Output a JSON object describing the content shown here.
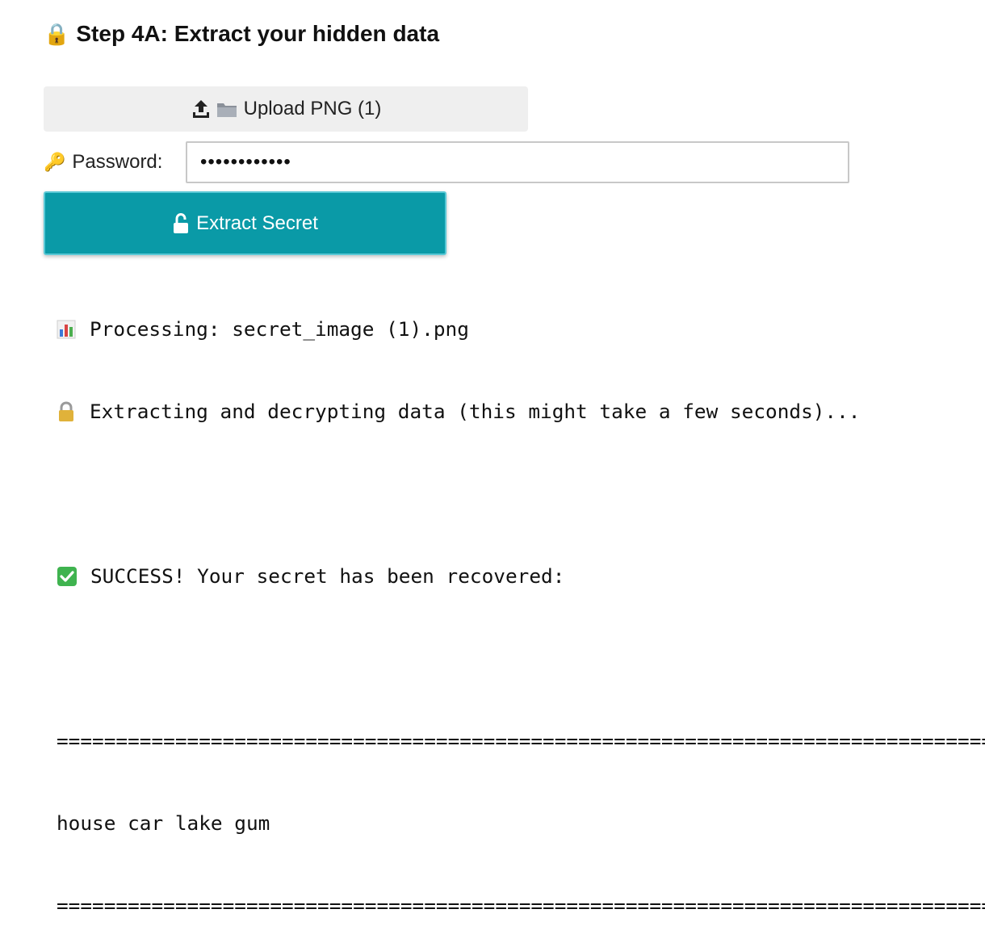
{
  "heading": {
    "icon": "lock-icon",
    "text": "Step 4A: Extract your hidden data"
  },
  "upload": {
    "label": "Upload PNG (1)",
    "icons": [
      "upload-icon",
      "folder-icon"
    ]
  },
  "password": {
    "icon": "key-icon",
    "label": "Password:",
    "value": "••••••••••••"
  },
  "extract": {
    "icon": "unlock-icon",
    "label": "Extract Secret",
    "color": "#0a9aa7"
  },
  "output": {
    "processing": "Processing: secret_image (1).png",
    "extracting": "Extracting and decrypting data (this might take a few seconds)...",
    "success": "SUCCESS! Your secret has been recovered:",
    "separator": "================================================================================",
    "secret": "house car lake gum",
    "separator_end": "================================================================================"
  }
}
